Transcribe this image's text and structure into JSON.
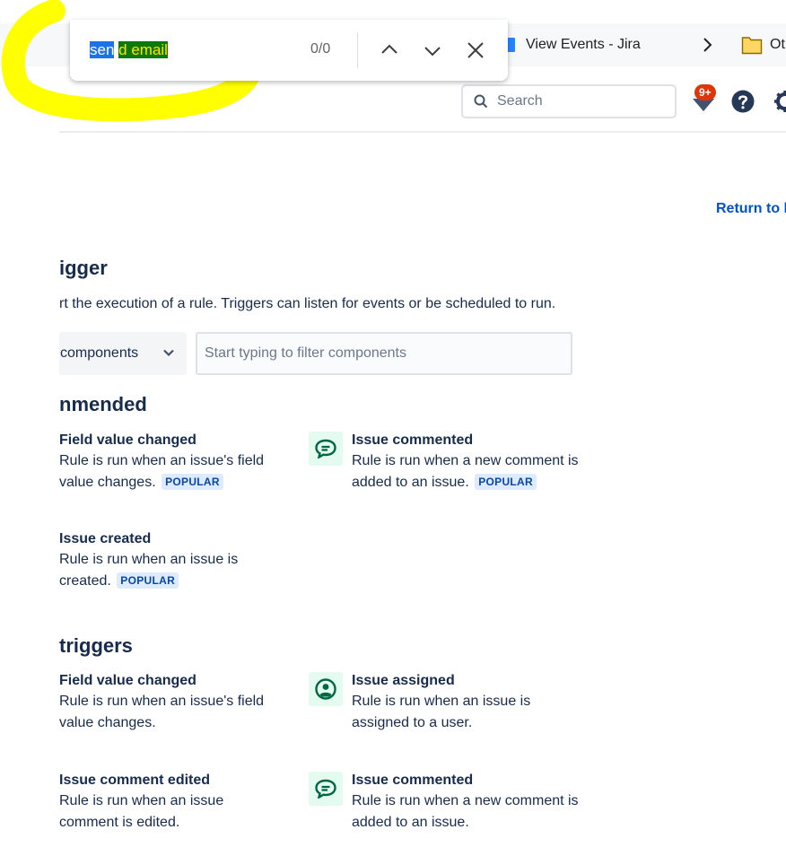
{
  "find_bar": {
    "query": "send email",
    "count": "0/0"
  },
  "bookmarks": {
    "tab_title": "View Events - Jira",
    "folder_label": "Ot"
  },
  "header": {
    "search_placeholder": "Search",
    "notification_count": "9+"
  },
  "page": {
    "return_link": "Return to l",
    "title": "igger",
    "description": "rt the execution of a rule. Triggers can listen for events or be scheduled to run.",
    "category_select": "components",
    "filter_placeholder": "Start typing to filter components"
  },
  "recommended": {
    "heading": "nmended",
    "items": [
      {
        "title": "Field value changed",
        "desc": "Rule is run when an issue's field value changes.",
        "badge": "POPULAR",
        "icon": ""
      },
      {
        "title": "Issue commented",
        "desc": "Rule is run when a new comment is added to an issue.",
        "badge": "POPULAR",
        "icon": "comment-icon"
      },
      {
        "title": "Issue created",
        "desc": "Rule is run when an issue is created.",
        "badge": "POPULAR",
        "icon": ""
      }
    ]
  },
  "triggers": {
    "heading": "triggers",
    "items": [
      {
        "title": "Field value changed",
        "desc": "Rule is run when an issue's field value changes.",
        "icon": ""
      },
      {
        "title": "Issue assigned",
        "desc": "Rule is run when an issue is assigned to a user.",
        "icon": "user-icon"
      },
      {
        "title": "Issue comment edited",
        "desc": "Rule is run when an issue comment is edited.",
        "icon": ""
      },
      {
        "title": "Issue commented",
        "desc": "Rule is run when a new comment is added to an issue.",
        "icon": "comment-icon"
      }
    ]
  },
  "colors": {
    "link": "#0052cc",
    "badge_bg": "#deebff",
    "badge_text": "#0747a6",
    "icon_bg": "#e3fcef",
    "icon_fg": "#006644",
    "highlight_marker": "#ffff00"
  }
}
